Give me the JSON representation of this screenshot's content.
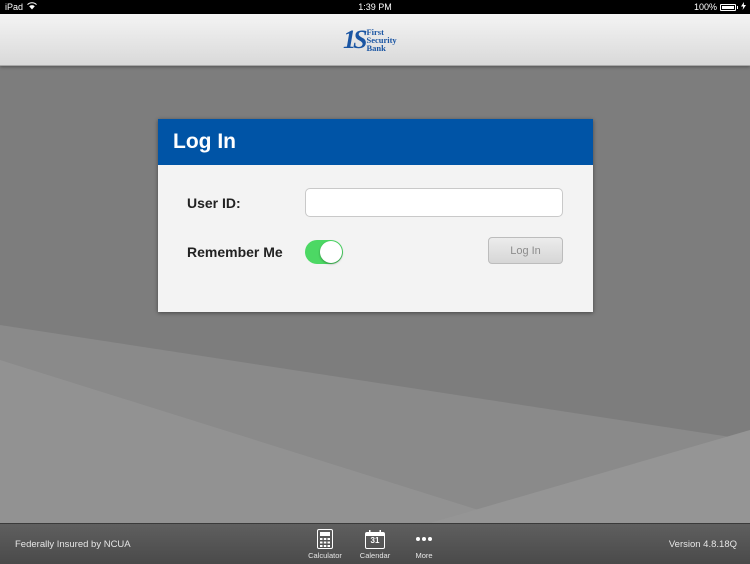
{
  "status_bar": {
    "device": "iPad",
    "time": "1:39 PM",
    "battery": "100%"
  },
  "header": {
    "logo_mark": "1S",
    "logo_lines": [
      "First",
      "Security",
      "Bank"
    ]
  },
  "login": {
    "title": "Log In",
    "user_id_label": "User ID:",
    "user_id_value": "",
    "remember_me_label": "Remember Me",
    "remember_me_on": true,
    "login_button": "Log In"
  },
  "footer": {
    "insured_text": "Federally Insured by NCUA",
    "version": "Version 4.8.18Q",
    "tabs": [
      {
        "label": "Calculator",
        "icon": "calculator-icon"
      },
      {
        "label": "Calendar",
        "icon": "calendar-icon",
        "day": "31"
      },
      {
        "label": "More",
        "icon": "more-icon"
      }
    ]
  },
  "colors": {
    "accent": "#0054a6",
    "toggle_on": "#4cd864",
    "background": "#7d7d7d"
  }
}
